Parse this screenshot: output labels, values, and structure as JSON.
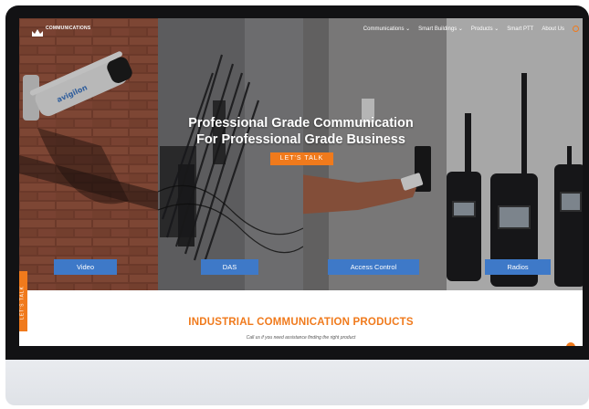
{
  "brand": {
    "name": "COMMUNICATIONS",
    "icon": "crown-logo-icon"
  },
  "nav": {
    "items": [
      {
        "label": "Communications",
        "has_dropdown": true
      },
      {
        "label": "Smart Buildings",
        "has_dropdown": true
      },
      {
        "label": "Products",
        "has_dropdown": true
      },
      {
        "label": "Smart PTT",
        "has_dropdown": false
      },
      {
        "label": "About Us",
        "has_dropdown": false
      }
    ],
    "search_icon": "search-icon"
  },
  "hero": {
    "headline_line1": "Professional Grade Communication",
    "headline_line2": "For Professional Grade Business",
    "cta_label": "LET'S TALK",
    "categories": [
      {
        "label": "Video"
      },
      {
        "label": "DAS"
      },
      {
        "label": "Access Control"
      },
      {
        "label": "Radios"
      }
    ],
    "camera_brand": "avigilon"
  },
  "side_tab": {
    "label": "LET'S TALK"
  },
  "products_section": {
    "title": "INDUSTRIAL COMMUNICATION PRODUCTS",
    "subtitle": "Call us if you need assistance finding the right product"
  },
  "colors": {
    "accent_orange": "#f07a1c",
    "button_blue": "#3e79c8",
    "device_frame": "#121214",
    "device_base": "#e3e6ea"
  }
}
